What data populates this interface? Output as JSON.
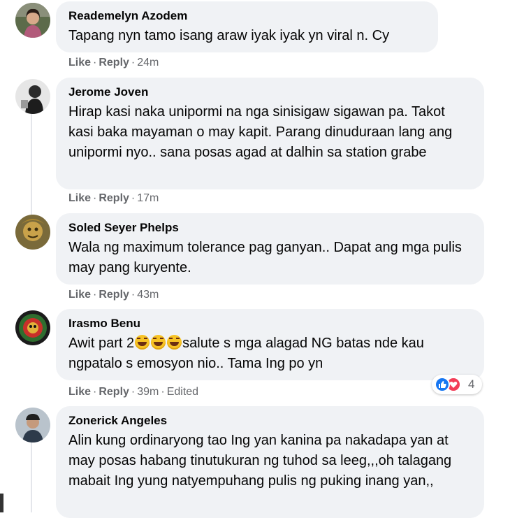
{
  "comments": [
    {
      "author": "Reademelyn Azodem",
      "text": "Tapang nyn tamo isang araw iyak iyak yn viral n. Cy",
      "like_label": "Like",
      "reply_label": "Reply",
      "time": "24m"
    },
    {
      "author": "Jerome Joven",
      "text": "Hirap kasi naka unipormi na nga sinisigaw sigawan pa. Takot kasi baka mayaman o may kapit. Parang dinuduraan lang ang unipormi nyo.. sana posas agad at dalhin sa station grabe",
      "like_label": "Like",
      "reply_label": "Reply",
      "time": "17m"
    },
    {
      "author": "Soled Seyer Phelps",
      "text": "Wala ng maximum tolerance pag ganyan.. Dapat ang mga pulis may pang kuryente.",
      "like_label": "Like",
      "reply_label": "Reply",
      "time": "43m"
    },
    {
      "author": "Irasmo Benu",
      "text_before": "Awit part 2",
      "emoji": "laughing-emoji",
      "emoji_count": 3,
      "text_after": "salute s mga alagad NG batas nde kau ngpatalo s emosyon nio.. Tama Ing po yn",
      "like_label": "Like",
      "reply_label": "Reply",
      "time": "39m",
      "edited": "Edited",
      "reaction_count": "4",
      "reactions": [
        "like-icon",
        "love-icon"
      ]
    },
    {
      "author": "Zonerick Angeles",
      "text": "Alin kung ordinaryong tao Ing yan kanina pa nakadapa yan at may posas habang tinutukuran ng tuhod sa leeg,,,oh talagang mabait Ing yung natyempuhang pulis ng puking inang yan,,"
    }
  ],
  "separator": "·",
  "colors": {
    "bubble": "#f0f2f5",
    "meta_text": "#65676b",
    "like_blue": "#1877f2",
    "love_red": "#f33e58"
  }
}
